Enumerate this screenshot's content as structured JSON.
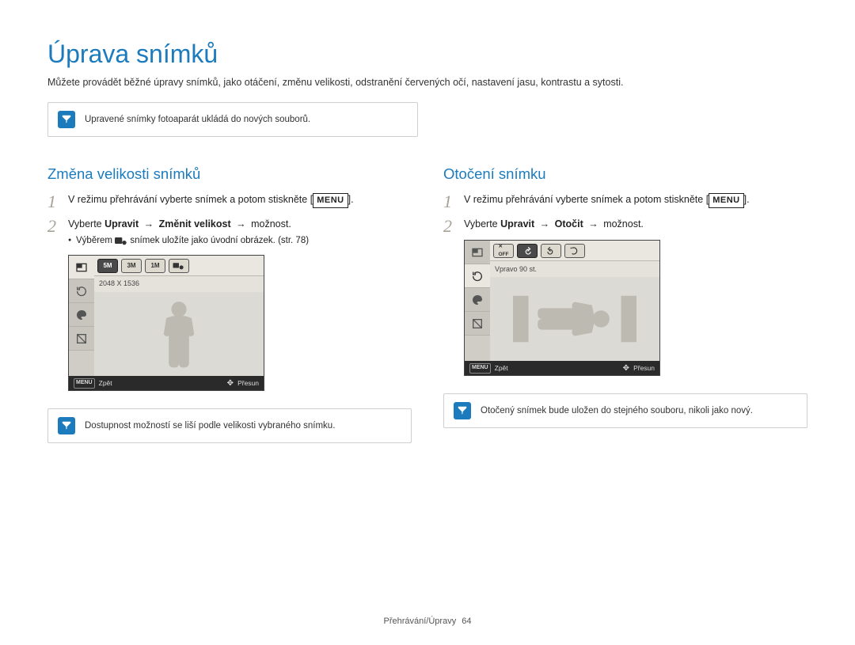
{
  "title": "Úprava snímků",
  "intro": "Můžete provádět běžné úpravy snímků, jako otáčení, změnu velikosti, odstranění červených očí, nastavení jasu, kontrastu a sytosti.",
  "note_top": "Upravené snímky fotoaparát ukládá do nových souborů.",
  "left": {
    "heading": "Změna velikosti snímků",
    "step1_pre": "V režimu přehrávání vyberte snímek a potom stiskněte ",
    "menu_btn": "MENU",
    "step1_post": ".",
    "step2_pre": "Vyberte ",
    "step2_b1": "Upravit",
    "arrow": " → ",
    "step2_b2": "Změnit velikost",
    "step2_post": " → možnost.",
    "bullet_pre": "Výběrem ",
    "bullet_post": " snímek uložíte jako úvodní obrázek. (str. 78)",
    "screen": {
      "status": "2048 X 1536",
      "chips": [
        "5M",
        "3M",
        "1M"
      ],
      "bottom_left": "Zpět",
      "bottom_menu": "MENU",
      "bottom_right": "Přesun"
    },
    "note_bottom": "Dostupnost možností se liší podle velikosti vybraného snímku."
  },
  "right": {
    "heading": "Otočení snímku",
    "step1_pre": "V režimu přehrávání vyberte snímek a potom stiskněte ",
    "menu_btn": "MENU",
    "step1_post": ".",
    "step2_pre": "Vyberte ",
    "step2_b1": "Upravit",
    "arrow": " → ",
    "step2_b2": "Otočit",
    "step2_post": " → možnost.",
    "screen": {
      "status": "Vpravo 90 st.",
      "bottom_left": "Zpět",
      "bottom_menu": "MENU",
      "bottom_right": "Přesun"
    },
    "note_bottom": "Otočený snímek bude uložen do stejného souboru, nikoli jako nový."
  },
  "footer": {
    "section": "Přehrávání/Úpravy",
    "page": "64"
  }
}
